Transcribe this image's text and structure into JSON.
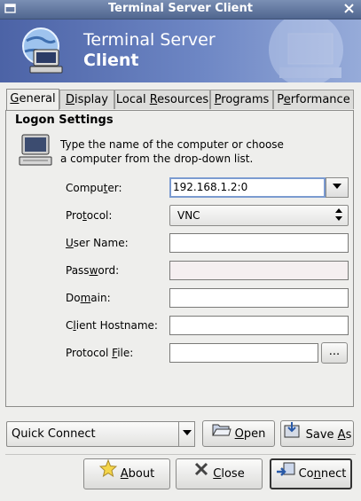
{
  "window": {
    "title": "Terminal Server Client"
  },
  "banner": {
    "line1": "Terminal Server",
    "line2": "Client"
  },
  "tabs": [
    {
      "label": "General",
      "u": "G",
      "rest": "eneral"
    },
    {
      "label": "Display",
      "u": "D",
      "rest": "isplay"
    },
    {
      "label": "Local Resources",
      "pre": "Local ",
      "u": "R",
      "rest": "esources"
    },
    {
      "label": "Programs",
      "pre": "",
      "u": "P",
      "rest": "rograms"
    },
    {
      "label": "Performance",
      "pre": "P",
      "u": "e",
      "rest": "rformance"
    }
  ],
  "logon": {
    "title": "Logon Settings",
    "description_line1": "Type the name of the computer or choose",
    "description_line2": "a computer from the drop-down list."
  },
  "fields": {
    "computer": {
      "label_pre": "Compu",
      "label_u": "t",
      "label_post": "er:",
      "value": "192.168.1.2:0"
    },
    "protocol": {
      "label_pre": "Pro",
      "label_u": "t",
      "label_post": "ocol:",
      "value": "VNC"
    },
    "username": {
      "label_pre": "",
      "label_u": "U",
      "label_post": "ser Name:",
      "value": ""
    },
    "password": {
      "label_pre": "Pass",
      "label_u": "w",
      "label_post": "ord:",
      "value": ""
    },
    "domain": {
      "label_pre": "Do",
      "label_u": "m",
      "label_post": "ain:",
      "value": ""
    },
    "client_hostname": {
      "label_pre": "C",
      "label_u": "l",
      "label_post": "ient Hostname:",
      "value": ""
    },
    "protocol_file": {
      "label_pre": "Protocol ",
      "label_u": "F",
      "label_post": "ile:",
      "value": "",
      "browse_label": "..."
    }
  },
  "quick_connect": {
    "value": "Quick Connect"
  },
  "buttons": {
    "open": {
      "u": "O",
      "rest": "pen"
    },
    "save_as": {
      "pre": "Save ",
      "u": "A",
      "rest": "s"
    },
    "about": {
      "u": "A",
      "rest": "bout"
    },
    "close": {
      "u": "C",
      "rest": "lose"
    },
    "connect": {
      "pre": "Co",
      "u": "n",
      "rest": "nect"
    }
  },
  "icons": {
    "window_close": "close-icon",
    "window_menu": "window-menu-icon",
    "open": "folder-open-icon",
    "save_as": "save-icon",
    "about": "star-icon",
    "close": "close-x-icon",
    "connect": "connect-icon"
  }
}
